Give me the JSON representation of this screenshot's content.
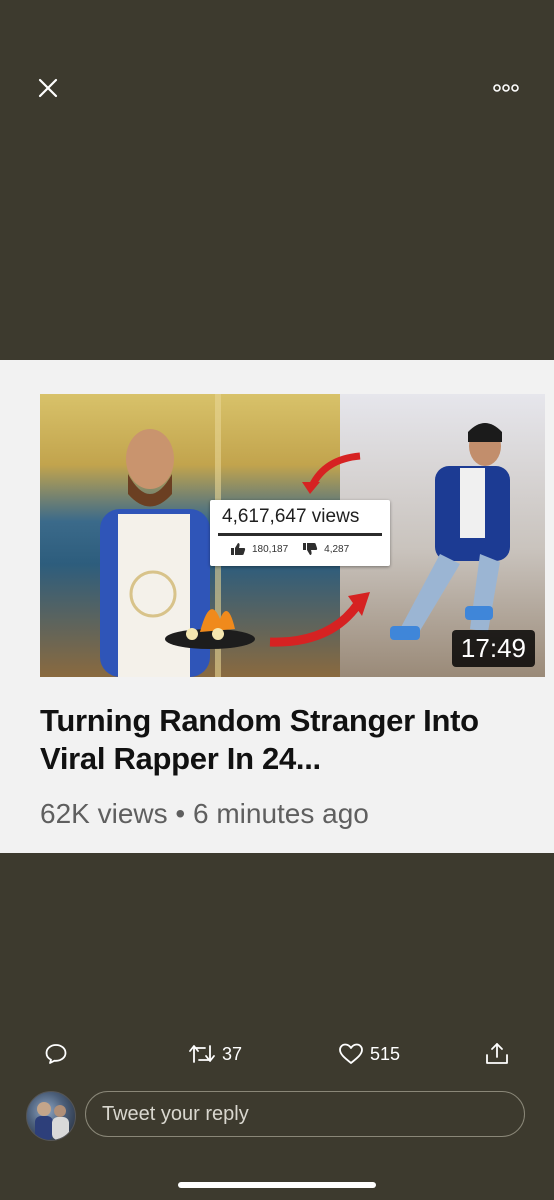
{
  "topbar": {
    "close_icon": "close-icon",
    "more_icon": "more-options-icon"
  },
  "media": {
    "thumbnail": {
      "views_text": "4,617,647 views",
      "likes": "180,187",
      "dislikes": "4,287",
      "duration": "17:49"
    },
    "title": "Turning Random Stranger Into Viral Rapper In 24...",
    "meta": "62K views • 6 minutes ago"
  },
  "actions": {
    "reply_icon": "reply-icon",
    "retweet_count": "37",
    "like_count": "515",
    "share_icon": "share-icon"
  },
  "reply": {
    "placeholder": "Tweet your reply"
  },
  "colors": {
    "background": "#3d3a2e",
    "card": "#f2f2f2",
    "text_light": "#ffffff"
  }
}
